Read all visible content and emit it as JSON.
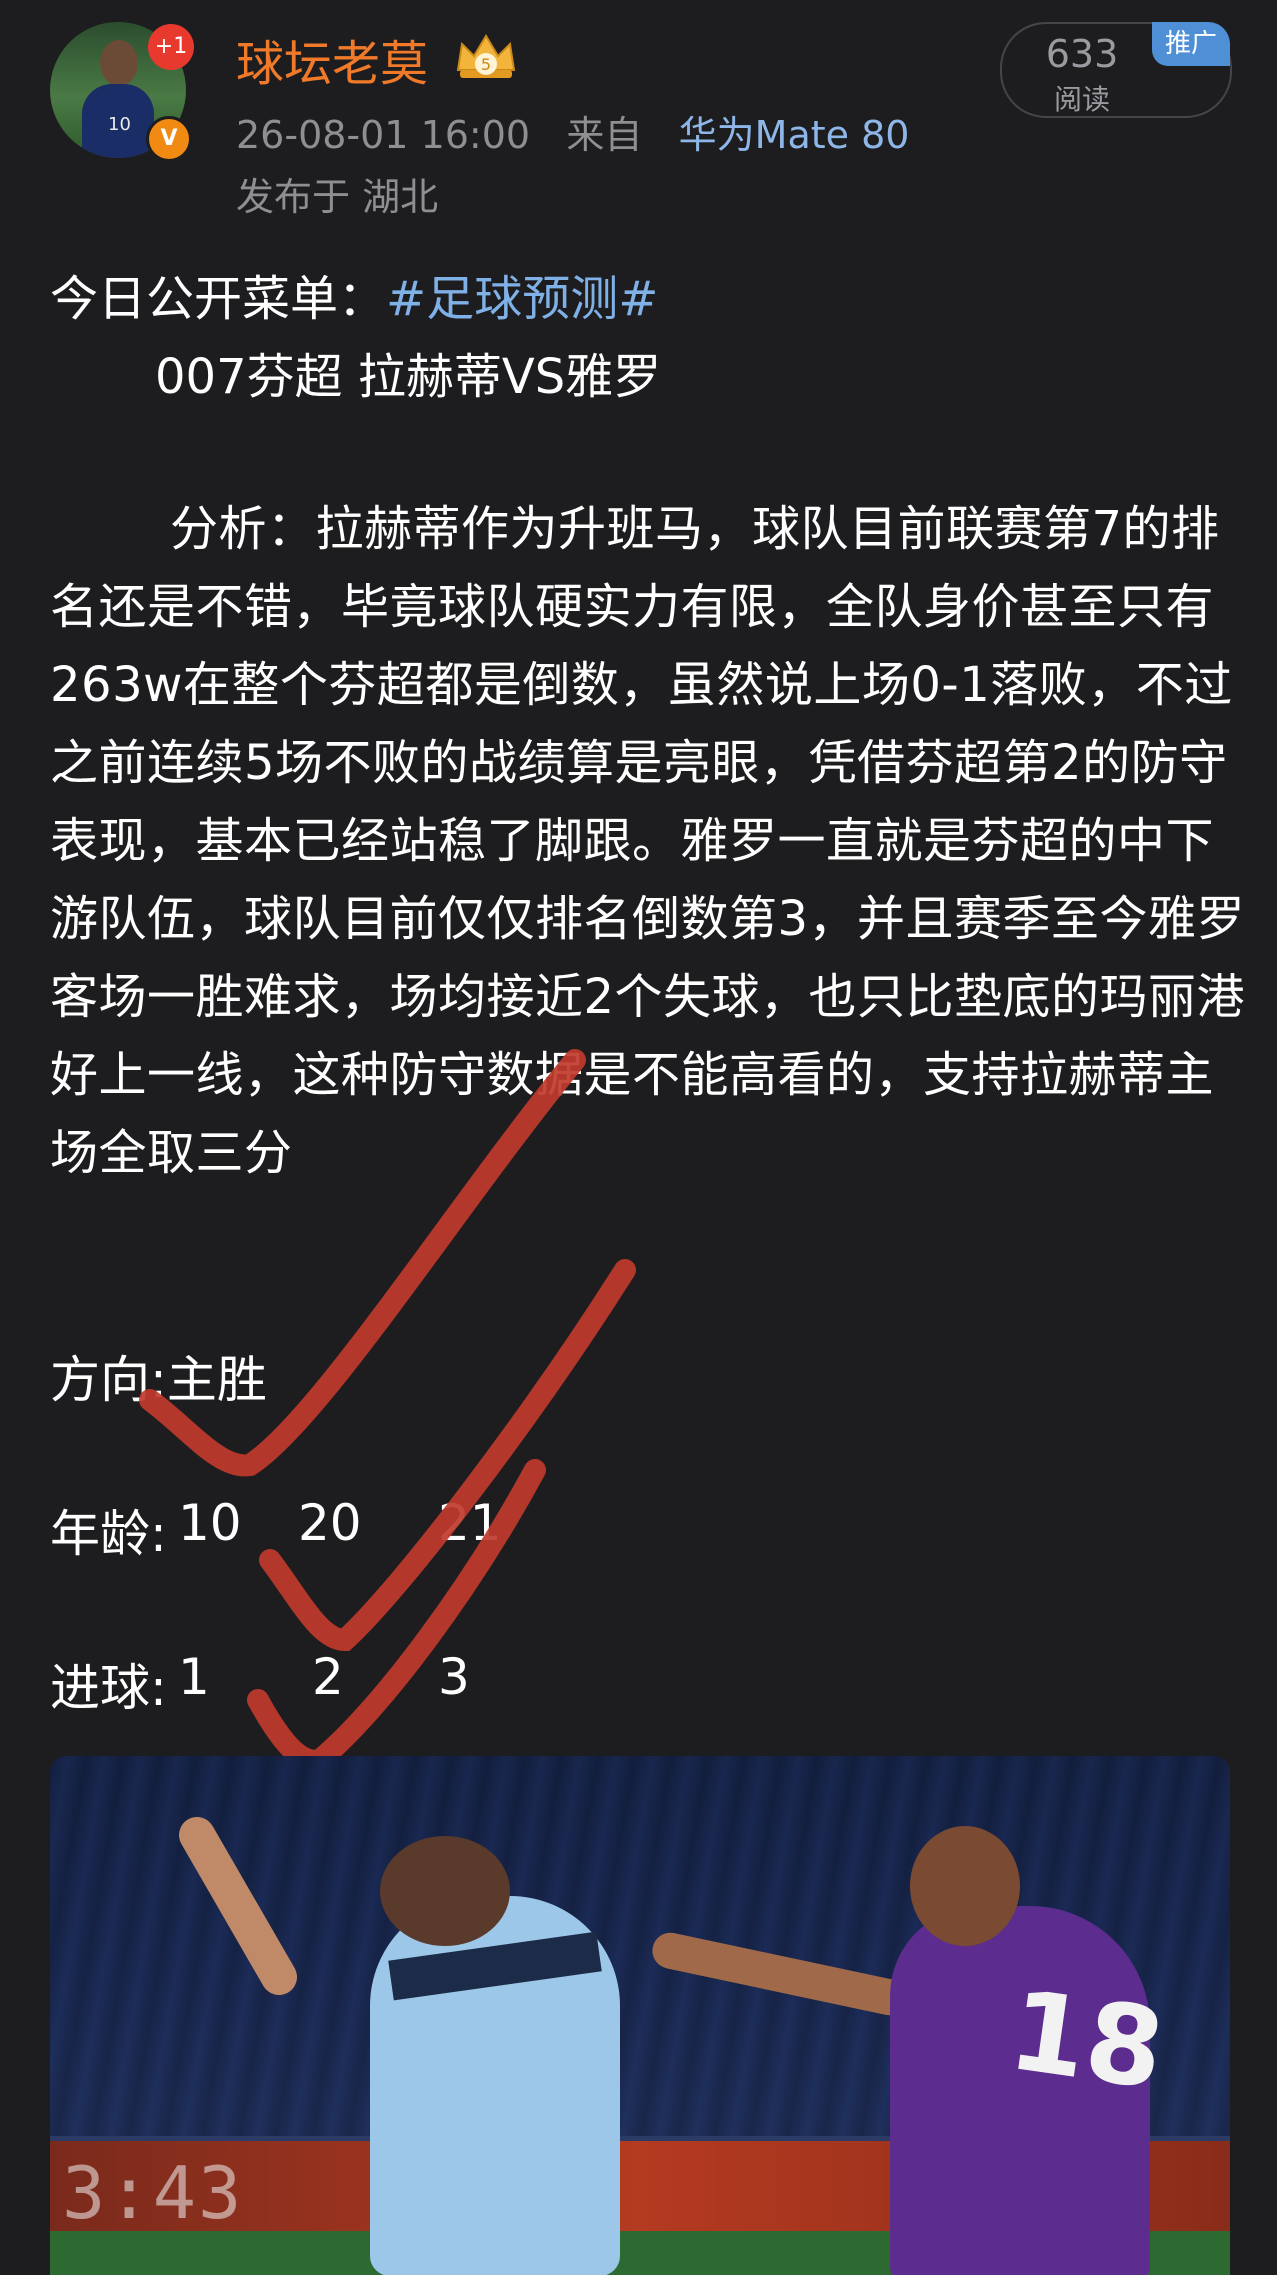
{
  "header": {
    "username": "球坛老莫",
    "notification_count": "+1",
    "verified_badge": "V",
    "crown_level": "5",
    "timestamp": "26-08-01 16:00",
    "source_prefix": "来自",
    "device": "华为Mate 80",
    "location": "发布于 湖北",
    "read_count": "633",
    "read_label": "阅读",
    "promo_label": "推广",
    "avatar_jersey_number": "10"
  },
  "post": {
    "intro_prefix": "今日公开菜单：",
    "topic_tag": "#足球预测#",
    "match_line": "007芬超 拉赫蒂VS雅罗",
    "analysis": "分析：拉赫蒂作为升班马，球队目前联赛第7的排名还是不错，毕竟球队硬实力有限，全队身价甚至只有263w在整个芬超都是倒数，虽然说上场0-1落败，不过之前连续5场不败的战绩算是亮眼，凭借芬超第2的防守表现，基本已经站稳了脚跟。雅罗一直就是芬超的中下游队伍，球队目前仅仅排名倒数第3，并且赛季至今雅罗客场一胜难求，场均接近2个失球，也只比垫底的玛丽港好上一线，这种防守数据是不能高看的，支持拉赫蒂主场全取三分",
    "direction": "方向:主胜",
    "age_label": "年龄:",
    "age_values": [
      "10",
      "20",
      "21"
    ],
    "goals_label": "进球:",
    "goal_values": [
      "1",
      "2",
      "3"
    ]
  },
  "image": {
    "clock_text": "3:43",
    "jersey_number": "18"
  },
  "colors": {
    "background": "#1d1d1f",
    "username": "#f07a2a",
    "link": "#7fb0e6",
    "meta": "#8e8e93",
    "check_mark": "#c0392b",
    "promo": "#4e8fd6"
  },
  "icons": {
    "crown": "crown-icon",
    "verified": "verified-icon",
    "checkmarks": "check-mark-icon"
  }
}
